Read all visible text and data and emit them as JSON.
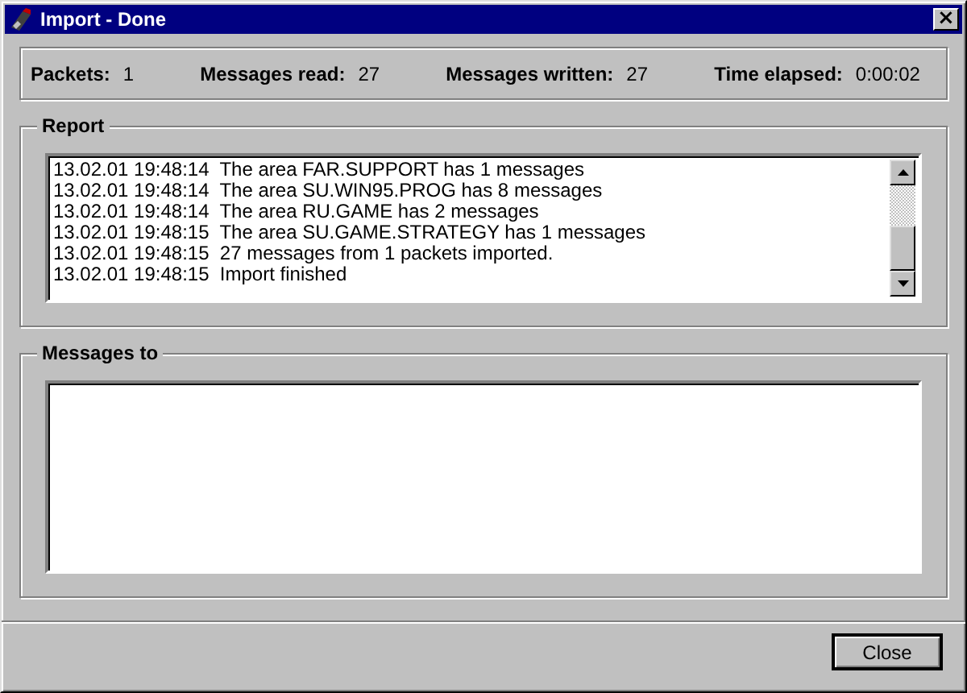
{
  "window": {
    "title": "Import - Done",
    "close_glyph": "×"
  },
  "stats": [
    {
      "label": "Packets:",
      "value": "1"
    },
    {
      "label": "Messages read:",
      "value": "27"
    },
    {
      "label": "Messages written:",
      "value": "27"
    },
    {
      "label": "Time elapsed:",
      "value": "0:00:02"
    }
  ],
  "report": {
    "title": "Report",
    "lines": [
      "13.02.01 19:48:14  The area FAR.SUPPORT has 1 messages",
      "13.02.01 19:48:14  The area SU.WIN95.PROG has 8 messages",
      "13.02.01 19:48:14  The area RU.GAME has 2 messages",
      "13.02.01 19:48:15  The area SU.GAME.STRATEGY has 1 messages",
      "13.02.01 19:48:15  27 messages from 1 packets imported.",
      "13.02.01 19:48:15  Import finished"
    ]
  },
  "messages_to": {
    "title": "Messages to"
  },
  "buttons": [
    {
      "label": "Close",
      "default": true
    }
  ]
}
